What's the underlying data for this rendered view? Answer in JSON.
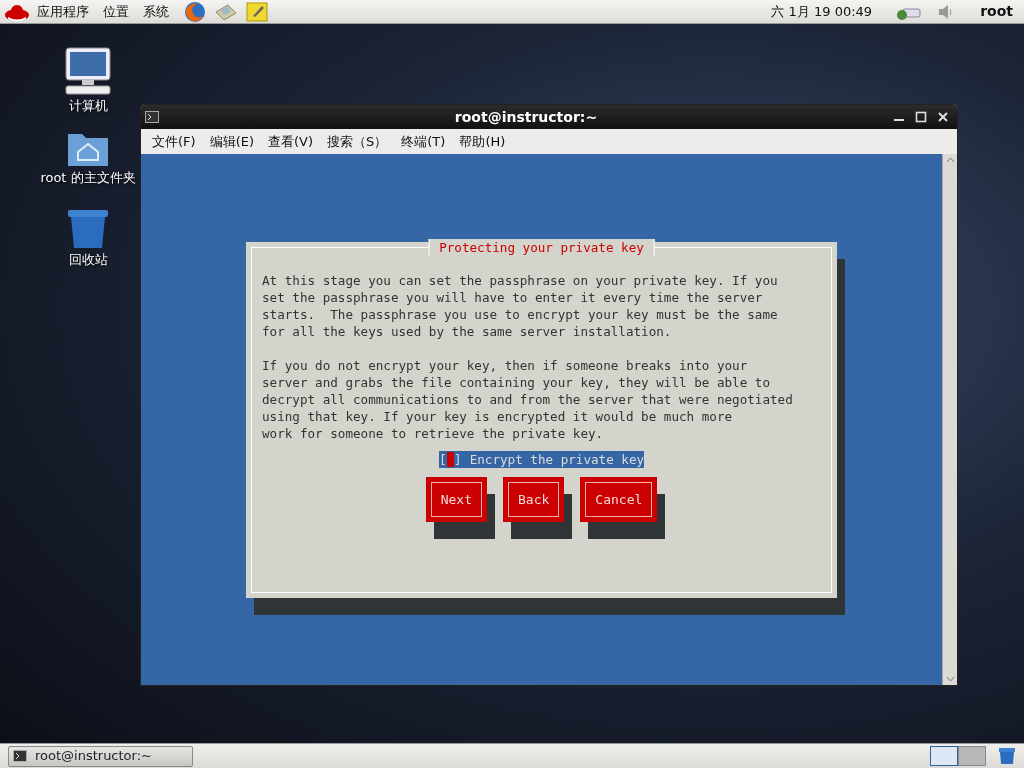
{
  "top_panel": {
    "menus": [
      "应用程序",
      "位置",
      "系统"
    ],
    "clock": "六 1月 19 00:49",
    "user": "root"
  },
  "desktop_icons": [
    {
      "label": "计算机",
      "kind": "computer"
    },
    {
      "label": "root 的主文件夹",
      "kind": "home"
    },
    {
      "label": "回收站",
      "kind": "trash"
    }
  ],
  "terminal_window": {
    "title": "root@instructor:~",
    "menus": [
      "文件(F)",
      "编辑(E)",
      "查看(V)",
      "搜索（S）",
      "终端(T)",
      "帮助(H)"
    ],
    "dialog": {
      "title": "Protecting your private key",
      "paragraphs": [
        "At this stage you can set the passphrase on your private key. If you\nset the passphrase you will have to enter it every time the server\nstarts.  The passphrase you use to encrypt your key must be the same\nfor all the keys used by the same server installation.",
        "If you do not encrypt your key, then if someone breaks into your\nserver and grabs the file containing your key, they will be able to\ndecrypt all communications to and from the server that were negotiated\nusing that key. If your key is encrypted it would be much more\nwork for someone to retrieve the private key."
      ],
      "checkbox": {
        "open_bracket": "[",
        "close_bracket": "]",
        "label": "Encrypt the private key",
        "checked": false,
        "focused": true
      },
      "buttons": [
        "Next",
        "Back",
        "Cancel"
      ]
    }
  },
  "taskbar": {
    "tasks": [
      {
        "label": "root@instructor:~"
      }
    ],
    "workspaces": [
      {
        "selected": true
      },
      {
        "selected": false
      }
    ]
  }
}
